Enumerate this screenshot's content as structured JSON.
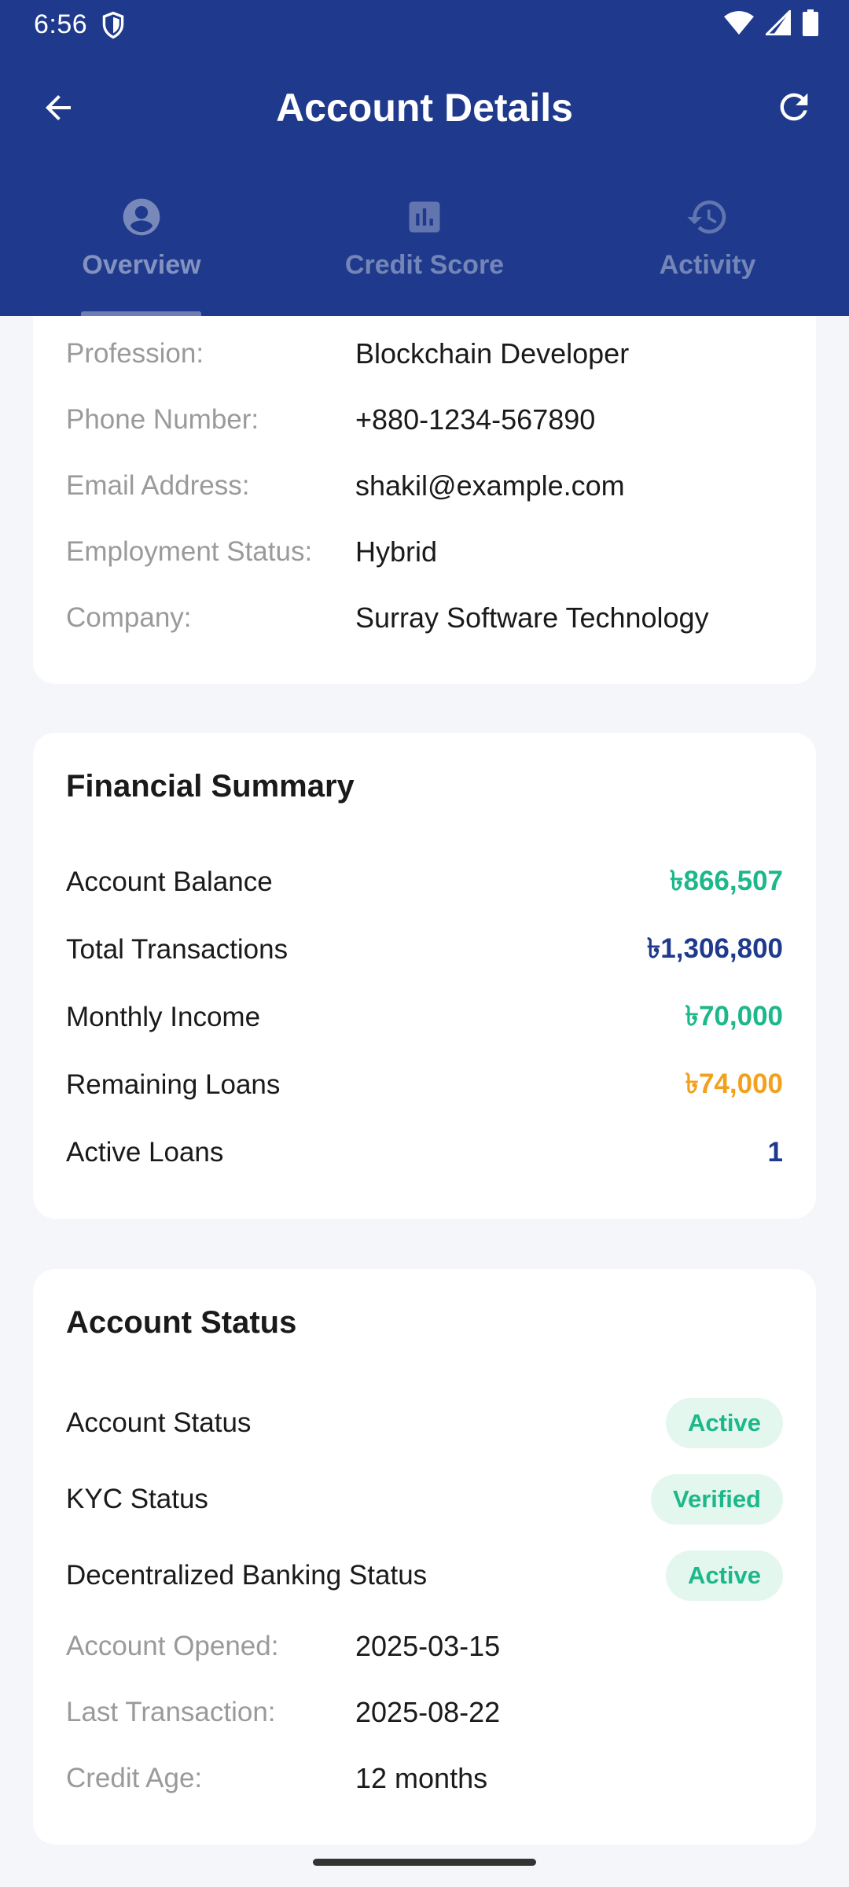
{
  "status_bar": {
    "time": "6:56"
  },
  "app_bar": {
    "title": "Account Details"
  },
  "tabs": [
    {
      "label": "Overview",
      "icon": "account-circle-icon",
      "active": true
    },
    {
      "label": "Credit Score",
      "icon": "bar-chart-icon",
      "active": false
    },
    {
      "label": "Activity",
      "icon": "history-icon",
      "active": false
    }
  ],
  "personal_info": {
    "rows": [
      {
        "label": "Profession:",
        "value": "Blockchain Developer"
      },
      {
        "label": "Phone Number:",
        "value": "+880-1234-567890"
      },
      {
        "label": "Email Address:",
        "value": "shakil@example.com"
      },
      {
        "label": "Employment Status:",
        "value": "Hybrid"
      },
      {
        "label": "Company:",
        "value": "Surray Software Technology"
      }
    ]
  },
  "financial_summary": {
    "title": "Financial Summary",
    "rows": [
      {
        "label": "Account Balance",
        "value": "৳866,507",
        "color": "#1DB88A"
      },
      {
        "label": "Total Transactions",
        "value": "৳1,306,800",
        "color": "#1F3A8C"
      },
      {
        "label": "Monthly Income",
        "value": "৳70,000",
        "color": "#1DB88A"
      },
      {
        "label": "Remaining Loans",
        "value": "৳74,000",
        "color": "#F2A11C"
      },
      {
        "label": "Active Loans",
        "value": "1",
        "color": "#1F3A8C"
      }
    ]
  },
  "account_status": {
    "title": "Account Status",
    "badges": [
      {
        "label": "Account Status",
        "value": "Active"
      },
      {
        "label": "KYC Status",
        "value": "Verified"
      },
      {
        "label": "Decentralized Banking Status",
        "value": "Active"
      }
    ],
    "rows": [
      {
        "label": "Account Opened:",
        "value": "2025-03-15"
      },
      {
        "label": "Last Transaction:",
        "value": "2025-08-22"
      },
      {
        "label": "Credit Age:",
        "value": "12 months"
      }
    ]
  },
  "colors": {
    "primary": "#1F3A8C",
    "green": "#1DB88A",
    "orange": "#F2A11C",
    "badge_bg": "#E3F7EF"
  }
}
